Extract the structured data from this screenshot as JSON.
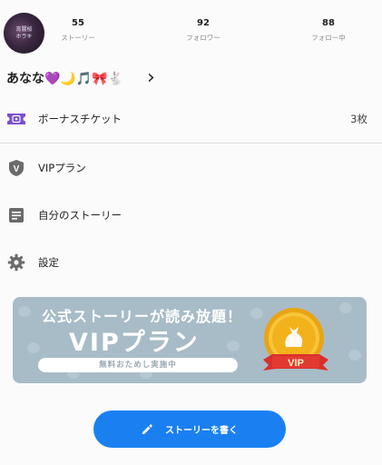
{
  "profile": {
    "avatar_text_line1": "宵闇桜",
    "avatar_text_line2": "ホラキ",
    "stats": [
      {
        "value": "55",
        "label": "ストーリー"
      },
      {
        "value": "92",
        "label": "フォロワー"
      },
      {
        "value": "88",
        "label": "フォロー中"
      }
    ],
    "username": "あなな💜🌙🎵🎀🐇",
    "chevron": "›"
  },
  "menu": {
    "items": [
      {
        "label": "ボーナスチケット",
        "value": "3枚",
        "icon": "ticket-icon"
      },
      {
        "label": "VIPプラン",
        "icon": "vip-shield-icon"
      },
      {
        "label": "自分のストーリー",
        "icon": "document-icon"
      },
      {
        "label": "設定",
        "icon": "gear-icon"
      }
    ]
  },
  "banner": {
    "headline": "公式ストーリーが読み放題！",
    "title": "VIPプラン",
    "pill": "無料おためし実施中",
    "medal_label": "VIP"
  },
  "write_button": {
    "label": "ストーリーを書く",
    "icon": "pencil-icon",
    "color": "#1a80f2"
  },
  "colors": {
    "accent": "#1a80f2",
    "ticket_icon": "#7a4fd6",
    "menu_icon": "#6b6b6b",
    "banner_bg": "#a8bcc7",
    "medal_gold": "#f2b21b",
    "ribbon_red": "#d9302c"
  }
}
